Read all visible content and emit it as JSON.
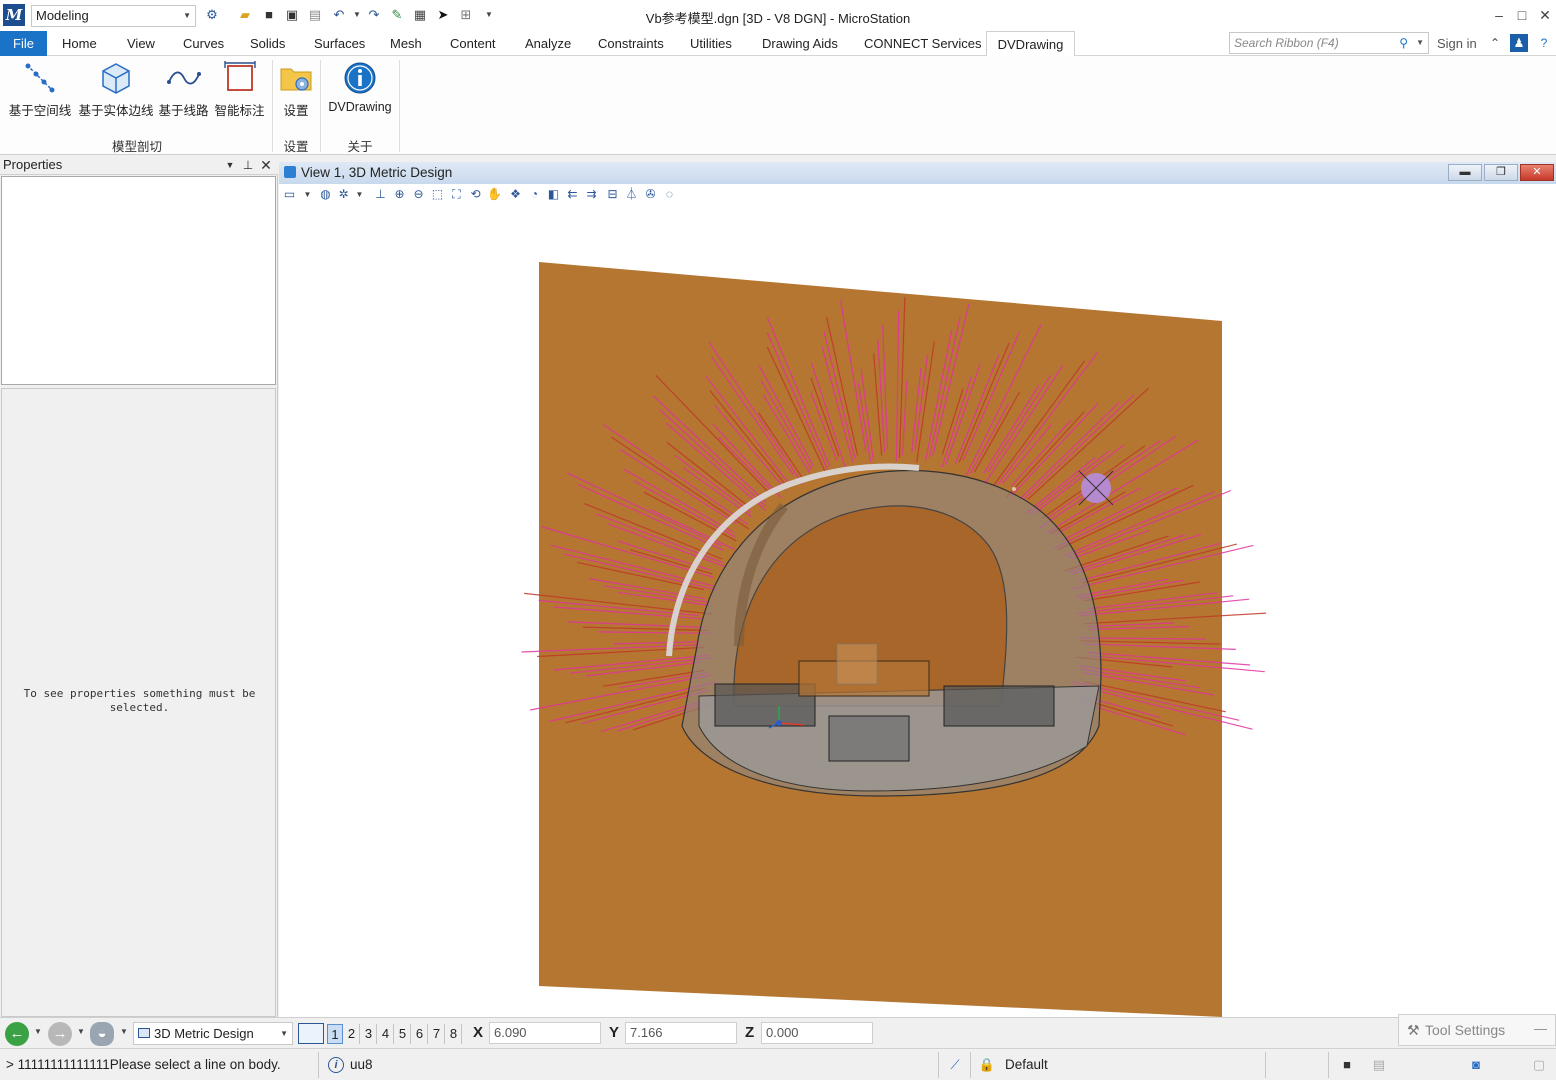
{
  "window": {
    "title": "Vb参考模型.dgn [3D - V8 DGN] - MicroStation",
    "workflow": "Modeling",
    "logo": "M"
  },
  "ribbon": {
    "tabs": [
      "File",
      "Home",
      "View",
      "Curves",
      "Solids",
      "Surfaces",
      "Mesh",
      "Content",
      "Analyze",
      "Constraints",
      "Utilities",
      "Drawing Aids",
      "CONNECT Services",
      "DVDrawing"
    ],
    "active_tab": "DVDrawing",
    "search_placeholder": "Search Ribbon (F4)",
    "sign_in": "Sign in",
    "buttons": [
      "基于空间线",
      "基于实体边线",
      "基于线路",
      "智能标注",
      "设置",
      "DVDrawing"
    ],
    "groups": [
      "模型剖切",
      "设置",
      "关于"
    ]
  },
  "properties": {
    "title": "Properties",
    "empty_message": "To see properties something must be selected."
  },
  "view": {
    "title": "View 1, 3D Metric Design",
    "plane_color": "#b57632",
    "bolt_color": "#e0329f",
    "bolt_alt_color": "#c03826"
  },
  "bottom": {
    "model": "3D Metric Design",
    "view_numbers": [
      "1",
      "2",
      "3",
      "4",
      "5",
      "6",
      "7",
      "8"
    ],
    "active_view": "1",
    "x_label": "X",
    "x_value": "6.090",
    "y_label": "Y",
    "y_value": "7.166",
    "z_label": "Z",
    "z_value": "0.000",
    "tool_settings": "Tool Settings"
  },
  "status": {
    "message": "> 11111111111111Please select a line on body.",
    "unit": "uu8",
    "level": "Default"
  },
  "colors": {
    "accent": "#1b73c7",
    "ribbon_active_border": "#cfcfcf"
  }
}
